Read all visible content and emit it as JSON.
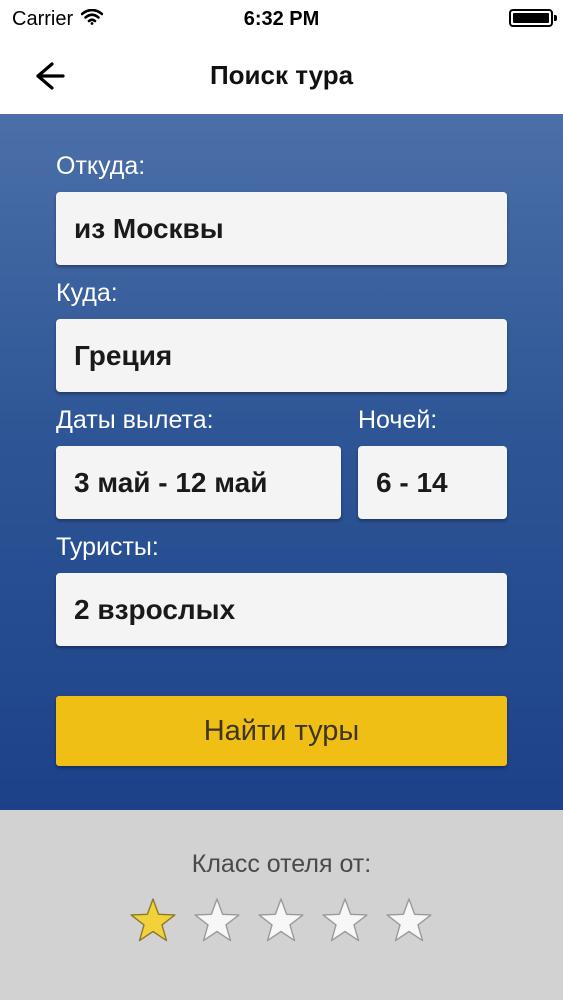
{
  "status_bar": {
    "carrier": "Carrier",
    "time": "6:32 PM",
    "icons": [
      "wifi-icon",
      "battery-icon"
    ]
  },
  "nav": {
    "title": "Поиск тура",
    "back_icon": "arrow-left-icon"
  },
  "form": {
    "from": {
      "label": "Откуда:",
      "value": "из Москвы"
    },
    "to": {
      "label": "Куда:",
      "value": "Греция"
    },
    "dates": {
      "label": "Даты вылета:",
      "value": "3 май - 12 май"
    },
    "nights": {
      "label": "Ночей:",
      "value": "6 - 14"
    },
    "tourists": {
      "label": "Туристы:",
      "value": "2 взрослых"
    },
    "search_button": "Найти туры"
  },
  "hotel_class": {
    "label": "Класс отеля от:",
    "rating": 1,
    "max": 5
  },
  "colors": {
    "panel_top": "#4b6fa8",
    "panel_bottom": "#1d4189",
    "button": "#efbf16",
    "star_active": "#f2d23a",
    "star_inactive": "#f7f7f7"
  }
}
